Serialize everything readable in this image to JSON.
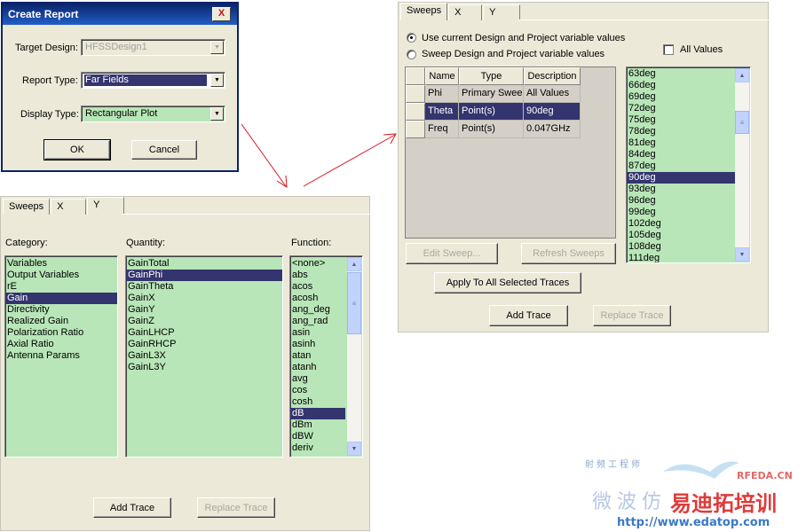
{
  "create_report": {
    "title": "Create Report",
    "close_label": "X",
    "target_design_label": "Target Design:",
    "target_design_value": "HFSSDesign1",
    "report_type_label": "Report Type:",
    "report_type_value": "Far Fields",
    "display_type_label": "Display Type:",
    "display_type_value": "Rectangular Plot",
    "ok_label": "OK",
    "cancel_label": "Cancel"
  },
  "left_panel": {
    "tabs": [
      "Sweeps",
      "X",
      "Y"
    ],
    "active_tab": "Y",
    "category_label": "Category:",
    "quantity_label": "Quantity:",
    "function_label": "Function:",
    "categories": [
      "Variables",
      "Output Variables",
      "rE",
      "Gain",
      "Directivity",
      "Realized Gain",
      "Polarization Ratio",
      "Axial Ratio",
      "Antenna Params"
    ],
    "selected_category": "Gain",
    "quantities": [
      "GainTotal",
      "GainPhi",
      "GainTheta",
      "GainX",
      "GainY",
      "GainZ",
      "GainLHCP",
      "GainRHCP",
      "GainL3X",
      "GainL3Y"
    ],
    "selected_quantity": "GainPhi",
    "functions": [
      "<none>",
      "abs",
      "acos",
      "acosh",
      "ang_deg",
      "ang_rad",
      "asin",
      "asinh",
      "atan",
      "atanh",
      "avg",
      "cos",
      "cosh",
      "dB",
      "dBm",
      "dBW",
      "deriv"
    ],
    "selected_function": "dB",
    "add_trace_label": "Add Trace",
    "replace_trace_label": "Replace Trace"
  },
  "right_panel": {
    "tabs": [
      "Sweeps",
      "X",
      "Y"
    ],
    "active_tab": "Sweeps",
    "radio_current": "Use current Design and Project variable values",
    "radio_sweep": "Sweep Design and Project variable values",
    "all_values_label": "All Values",
    "table_headers": [
      "Name",
      "Type",
      "Description"
    ],
    "table_rows": [
      {
        "name": "Phi",
        "type": "Primary Sweep",
        "description": "All Values"
      },
      {
        "name": "Theta",
        "type": "Point(s)",
        "description": "90deg"
      },
      {
        "name": "Freq",
        "type": "Point(s)",
        "description": "0.047GHz"
      }
    ],
    "selected_row": 1,
    "values": [
      "63deg",
      "66deg",
      "69deg",
      "72deg",
      "75deg",
      "78deg",
      "81deg",
      "84deg",
      "87deg",
      "90deg",
      "93deg",
      "96deg",
      "99deg",
      "102deg",
      "105deg",
      "108deg",
      "111deg"
    ],
    "selected_value": "90deg",
    "edit_sweep_label": "Edit Sweep...",
    "refresh_sweeps_label": "Refresh Sweeps",
    "apply_all_label": "Apply To All Selected Traces",
    "add_trace_label": "Add Trace",
    "replace_trace_label": "Replace Trace"
  },
  "watermark": {
    "site_cn_small": "射频工程师",
    "site_en": "RFEDA.CN",
    "brand_cn_left": "微波仿",
    "brand_cn_right": "易迪拓培训",
    "url": "http://www.edatop.com"
  },
  "colors": {
    "list_bg": "#b8e6b8",
    "selection": "#34346e",
    "titlebar": "#0a246a",
    "arrow": "#d8141e",
    "watermark_red": "#e03a3a",
    "watermark_blue": "#3a78c8"
  }
}
